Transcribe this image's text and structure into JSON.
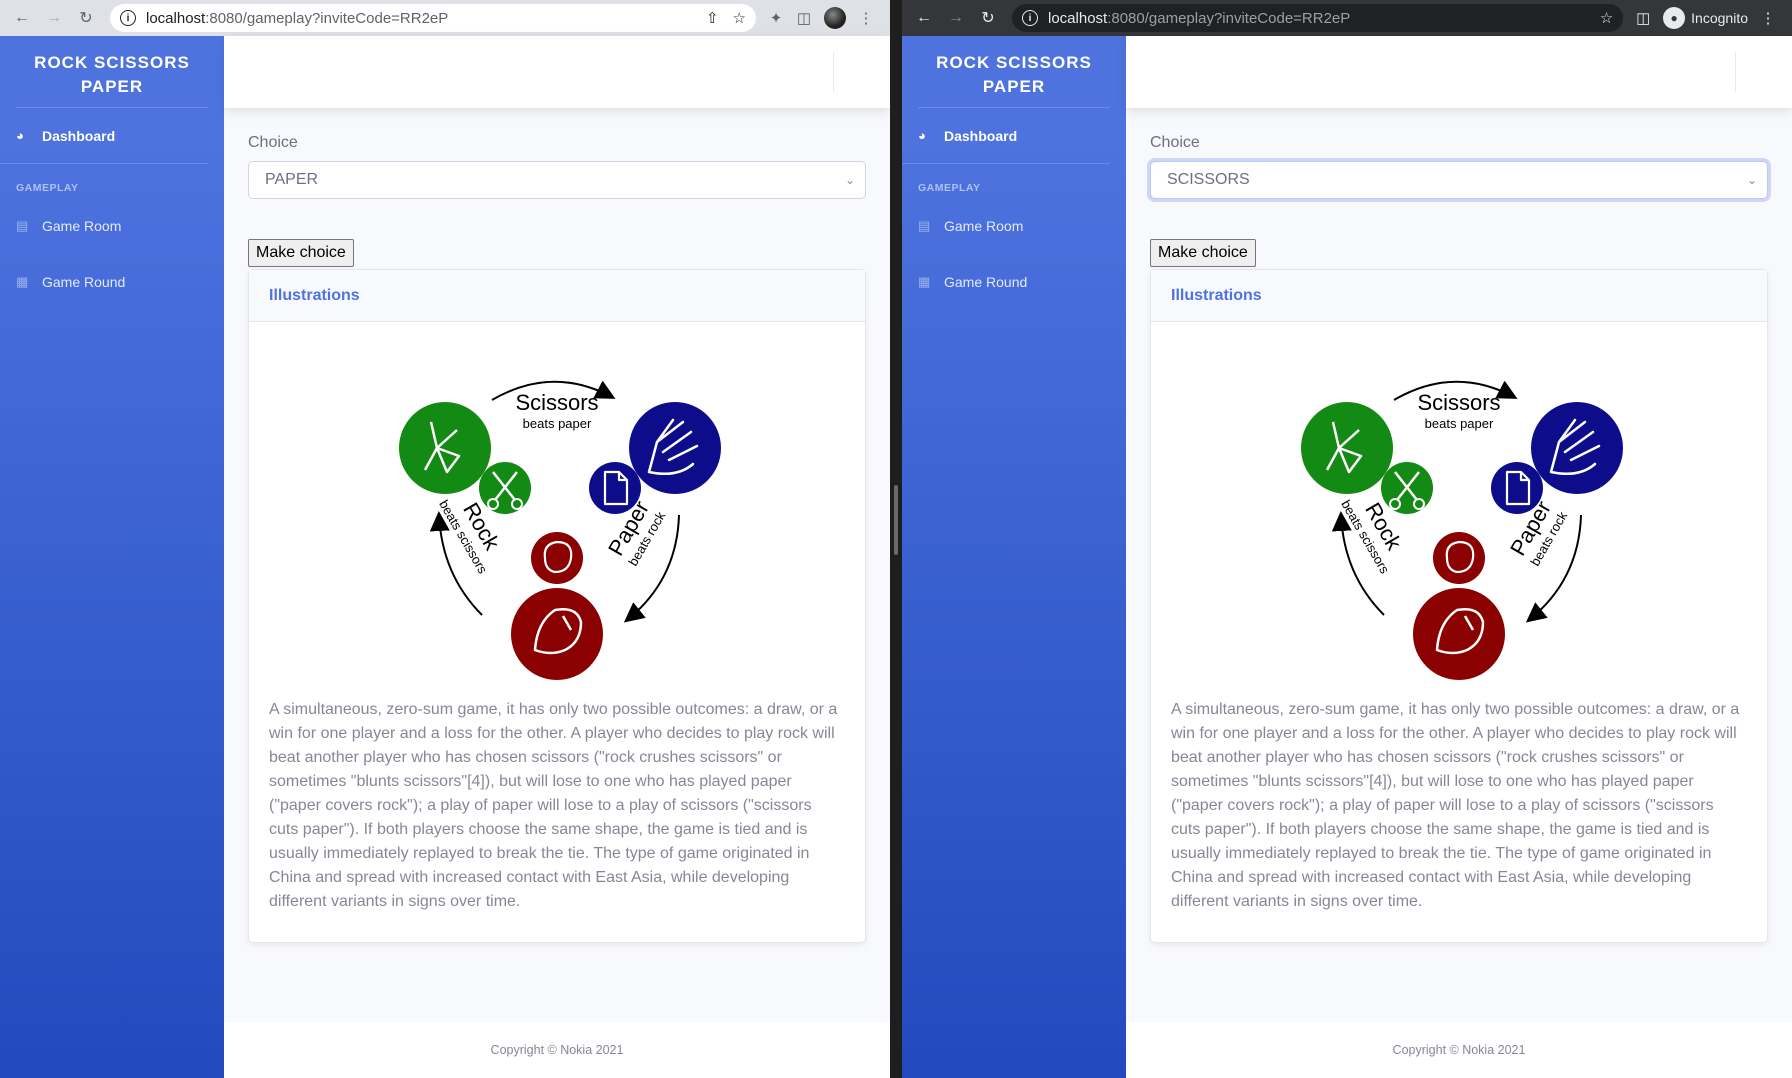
{
  "windows": [
    {
      "browser": {
        "url_host": "localhost",
        "url_path": ":8080/gameplay?inviteCode=RR2eP",
        "profile_label": ""
      },
      "select_value": "PAPER"
    },
    {
      "browser": {
        "url_host": "localhost",
        "url_path": ":8080/gameplay?inviteCode=RR2eP",
        "profile_label": "Incognito"
      },
      "select_value": "SCISSORS"
    }
  ],
  "sidebar": {
    "brand": "ROCK SCISSORS PAPER",
    "dashboard": "Dashboard",
    "heading": "GAMEPLAY",
    "items": [
      {
        "label": "Game Room",
        "icon": "chart-area-icon"
      },
      {
        "label": "Game Round",
        "icon": "table-icon"
      }
    ]
  },
  "main": {
    "choice_label": "Choice",
    "make_choice": "Make choice",
    "card_title": "Illustrations",
    "illustration": {
      "scissors": "Scissors",
      "scissors_sub": "beats paper",
      "rock": "Rock",
      "rock_sub": "beats scissors",
      "paper": "Paper",
      "paper_sub": "beats rock"
    },
    "description": "A simultaneous, zero-sum game, it has only two possible outcomes: a draw, or a win for one player and a loss for the other. A player who decides to play rock will beat another player who has chosen scissors (\"rock crushes scissors\" or sometimes \"blunts scissors\"[4]), but will lose to one who has played paper (\"paper covers rock\"); a play of paper will lose to a play of scissors (\"scissors cuts paper\"). If both players choose the same shape, the game is tied and is usually immediately replayed to break the tie. The type of game originated in China and spread with increased contact with East Asia, while developing different variants in signs over time.",
    "footer": "Copyright © Nokia 2021"
  },
  "colors": {
    "sidebar_top": "#4e73df",
    "sidebar_bottom": "#224abe",
    "scissors_green": "#138a13",
    "paper_blue": "#0d0d8c",
    "rock_red": "#8b0000"
  }
}
